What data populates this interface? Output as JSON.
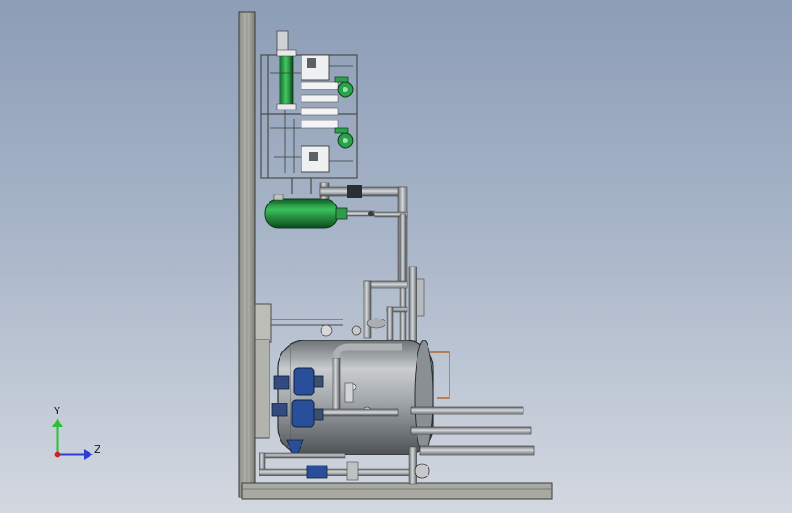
{
  "viewport": {
    "background_top": "#8c9db6",
    "background_bottom": "#d3d8e0"
  },
  "triad": {
    "y_label": "Y",
    "z_label": "Z",
    "y_color": "#2fbf3a",
    "z_color": "#2b3fd6",
    "origin_color": "#d02020"
  },
  "colors": {
    "steel": "#9ea3a8",
    "frame": "#a8a8a2",
    "green_vessel": "#1f8a3a",
    "pump_blue": "#2a4f9a",
    "copper_line": "#b5652a"
  }
}
